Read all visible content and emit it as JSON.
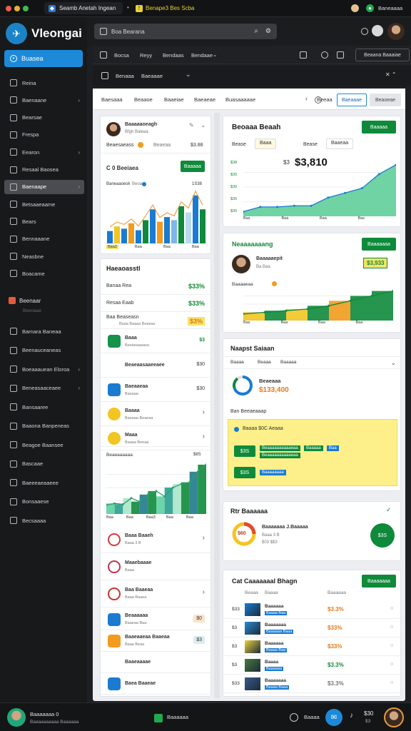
{
  "colors": {
    "accent": "#1c8ad8",
    "brand_green": "#0e8a3a",
    "chart_teal": "#5cd0a0",
    "warning_yellow": "#fdf08a",
    "orange": "#e47a18"
  },
  "browser": {
    "tab_title": "Seamb Anetah Ingean",
    "second_tab": "Benape3 Bes Scba",
    "profile_label": "Baneaaaa"
  },
  "app": {
    "name": "Vleongai"
  },
  "sidebar": {
    "primary_button": "Buasea",
    "items": [
      {
        "label": "Reina",
        "icon": "document-icon",
        "chevron": false
      },
      {
        "label": "Baenaane",
        "icon": "image-icon",
        "chevron": true
      },
      {
        "label": "Bearsae",
        "icon": "list-icon",
        "chevron": false
      },
      {
        "label": "Frespa",
        "icon": "folder-icon",
        "chevron": false
      },
      {
        "label": "Eearon",
        "icon": "mail-icon",
        "chevron": true
      },
      {
        "label": "Resaal Baosea",
        "icon": "calendar-icon",
        "chevron": false
      },
      {
        "label": "Baenaape",
        "icon": "camera-icon",
        "chevron": true
      },
      {
        "label": "Betsaaeaame",
        "icon": "globe-icon",
        "chevron": false
      },
      {
        "label": "Bears",
        "icon": "box-icon",
        "chevron": false
      },
      {
        "label": "Bennaaane",
        "icon": "pencil-icon",
        "chevron": false
      },
      {
        "label": "Neasbne",
        "icon": "grid-icon",
        "chevron": false
      },
      {
        "label": "Boacame",
        "icon": "lock-icon",
        "chevron": false
      }
    ],
    "section_label": "Beenaar",
    "section_sub": "Beenaae",
    "items2": [
      {
        "label": "Barnara Baneaa",
        "icon": "stack-icon",
        "chevron": false
      },
      {
        "label": "Beenauceaneas",
        "icon": "share-icon",
        "chevron": false
      },
      {
        "label": "Boeaaauean Eloroa",
        "icon": "folder-icon",
        "chevron": true
      },
      {
        "label": "Beneasaaceaee",
        "icon": "clipboard-icon",
        "chevron": true
      },
      {
        "label": "Bansaaree",
        "icon": "image-icon",
        "chevron": false
      },
      {
        "label": "Baaona Banpeneas",
        "icon": "video-icon",
        "chevron": false
      },
      {
        "label": "Beagoe Baansee",
        "icon": "camera-icon",
        "chevron": false
      },
      {
        "label": "Bascaae",
        "icon": "table-icon",
        "chevron": false
      },
      {
        "label": "Baeeeaeaaeee",
        "icon": "contact-icon",
        "chevron": false
      },
      {
        "label": "Bonsaaese",
        "icon": "window-icon",
        "chevron": false
      },
      {
        "label": "Becsaaaa",
        "icon": "mail-icon",
        "chevron": false
      }
    ]
  },
  "topbar": {
    "search_placeholder": "Boa Bearana"
  },
  "toolbar1": {
    "items": [
      "Bocsa",
      "Reyy",
      "Bendaas",
      "Bendaae"
    ],
    "right_label": "Beaana Baaaiae"
  },
  "toolbar2": {
    "items": [
      "Benaaa",
      "Baeaaae"
    ]
  },
  "tabs": {
    "items": [
      "Baesaaa",
      "Beaaoe",
      "Baaeiae",
      "Baeaeae",
      "Buasaaaaae"
    ],
    "right_text": "Beeaa",
    "active_button": "Baeaaae",
    "second_button": "Beaoeae"
  },
  "card_left_1": {
    "title": "Baaaaaoeagh",
    "subtitle": "Bfgh Baleaa",
    "row_label": "Beaesaeass",
    "row_mid": "Beaeaa",
    "row_right": "$3.88",
    "sub_title": "C 0 Beeiaea",
    "button": "Baaaaa",
    "chart_label": "Baneaaoesk",
    "chart_meta": "Beoa",
    "chart_top": "1S38",
    "x_labels": [
      "Baa3",
      "Baa",
      "Baa",
      "Baa"
    ],
    "chart_data": {
      "type": "bar",
      "categories": [
        "1",
        "2",
        "3",
        "4",
        "5",
        "6",
        "7",
        "8",
        "9",
        "10",
        "11",
        "12",
        "13",
        "14"
      ],
      "series": [
        {
          "values": [
            16,
            22,
            19,
            26,
            17,
            30,
            44,
            28,
            34,
            30,
            48,
            40,
            62,
            44
          ]
        }
      ],
      "ylim": [
        0,
        70
      ]
    }
  },
  "card_left_2": {
    "title": "Haeaoasstl",
    "rows": [
      {
        "label": "Banaa Rea",
        "value": "$33%"
      },
      {
        "label": "Resaa Eaab",
        "value": "$33%"
      },
      {
        "label": "Baa Beaseasn",
        "sub": "Baaa Baaaa Beaeas",
        "value": "$3%"
      }
    ]
  },
  "list_items": [
    {
      "title": "Baaa",
      "sub": "Beeaeaaaasa",
      "right": "$3",
      "color": "#16924a",
      "icon": "tag-icon"
    },
    {
      "title": "Beaeaasaaeeaee",
      "sub": "",
      "right": "$30",
      "color": "#ffffff",
      "icon": "bolt-icon"
    },
    {
      "title": "Baeaaeaa",
      "sub": "Baeaaa",
      "right": "$30",
      "color": "#1a7bd0",
      "icon": "document-icon"
    },
    {
      "title": "Baaaa",
      "sub": "Baeaaa Beaeaa",
      "right": "",
      "color": "#f2c522",
      "icon": "coin-icon"
    },
    {
      "title": "Maaa",
      "sub": "Baaaa Beeaa",
      "right": "",
      "color": "#f2c522",
      "icon": "bulb-icon"
    }
  ],
  "card_left_3": {
    "title": "Beaeaaaaaa",
    "chart_top": "$8S",
    "x_labels": [
      "Baa",
      "Baa",
      "Baa3",
      "Baa",
      "Baa"
    ],
    "chart_data": {
      "type": "area",
      "categories": [
        "1",
        "2",
        "3",
        "4",
        "5",
        "6",
        "7",
        "8",
        "9",
        "10",
        "11",
        "12",
        "13"
      ],
      "series": [
        {
          "values": [
            10,
            12,
            11,
            18,
            14,
            22,
            26,
            20,
            30,
            34,
            36,
            48,
            56
          ]
        }
      ],
      "ylim": [
        0,
        60
      ]
    }
  },
  "list_items2": [
    {
      "title": "Baaa Baaeh",
      "sub": "Baaa 3 B",
      "color": "#d33b3b",
      "icon": "alert-icon"
    },
    {
      "title": "Maaebaaae",
      "sub": "Baaa",
      "color": "#c2334d",
      "icon": "heart-icon"
    },
    {
      "title": "Baa Baaeaa",
      "sub": "Baaa Baaea",
      "color": "#c8352f",
      "icon": "camera-icon"
    }
  ],
  "list_items3": [
    {
      "title": "Beaaaaaa",
      "sub": "Baaeaa Baa",
      "badge": "$0",
      "color": "#1a7bd0",
      "icon": "folder-icon"
    },
    {
      "title": "Baaeaaeaa Baaeaa",
      "sub": "Baaa Beaa",
      "badge": "$3",
      "color": "#f29b1e",
      "icon": "grid-icon"
    },
    {
      "title": "Baaeaaaae",
      "sub": "",
      "badge": "",
      "color": "#ffffff",
      "icon": "dot-icon"
    },
    {
      "title": "Baea Baaeae",
      "sub": "",
      "badge": "",
      "color": "#1a7bd0",
      "icon": "box-icon"
    }
  ],
  "card_right_1": {
    "title": "Beoaaa Beaah",
    "tag1": "Baaa",
    "tag2": "Baaeaa",
    "label": "Bease",
    "button": "Baaaaa",
    "value": "$3,810",
    "small_value": "$3",
    "x_labels": [
      "Bas",
      "Baa",
      "Baa",
      "Bas"
    ],
    "y_labels": [
      "$38",
      "$30",
      "$30",
      "$30",
      "$30"
    ],
    "chart_data": {
      "type": "area",
      "categories": [
        "1",
        "2",
        "3",
        "4",
        "5",
        "6",
        "7",
        "8",
        "9",
        "10"
      ],
      "series": [
        {
          "values": [
            4,
            8,
            8,
            9,
            9,
            16,
            20,
            24,
            36,
            44
          ]
        }
      ],
      "ylim": [
        0,
        50
      ]
    }
  },
  "card_right_2": {
    "title": "Neaaaaaaang",
    "button": "Baaaaaaa",
    "name": "Baaaaaepit",
    "sub": "Ba Baa",
    "value_badge": "$3,933",
    "row_label": "Baaaaeaa",
    "x_labels": [
      "Bas",
      "Baa",
      "Baa",
      "Baa"
    ],
    "chart_data": {
      "type": "area",
      "categories": [
        "1",
        "2",
        "3",
        "4",
        "5",
        "6",
        "7",
        "8"
      ],
      "series": [
        {
          "values": [
            8,
            10,
            12,
            14,
            18,
            24,
            30,
            36
          ]
        }
      ],
      "ylim": [
        0,
        40
      ]
    }
  },
  "card_right_3": {
    "title": "Naapst Saiaan",
    "tabs": [
      "Baaaa",
      "Beaaa",
      "Baaaaa"
    ],
    "donut_title": "Beaeaaa",
    "donut_value": "$133,400",
    "section": "Ban Beeaeaaap",
    "alert_title": "Baaaa $0C Aeaaa",
    "alert_rows": [
      {
        "value": "$3S",
        "label": "Beaaaaaaaaaaeaa",
        "pill": "Baaaaa",
        "pill2": "Baa"
      },
      {
        "value": "$3S",
        "label": "Baaaaaaaa"
      }
    ],
    "donut": {
      "values": [
        70,
        20,
        10
      ]
    }
  },
  "card_right_4": {
    "title": "Rtr Baaaaaa",
    "gauge_label": "$60",
    "name": "Baaaaaaa J.Baaaaa",
    "sub": "Baaa 3 B",
    "sub2": "$03 $$3",
    "circle": "$3S"
  },
  "card_right_5": {
    "title": "Cat Caaaaaaal Bhagn",
    "button": "Baaaaaaa",
    "headers": [
      "Beaaa",
      "Baaaa",
      "Baaaaaa"
    ],
    "rows": [
      {
        "n": "$33",
        "name": "Baaaaaa",
        "sub": "Baaaa Baa",
        "value": "$3.3%",
        "color": "#e47a18"
      },
      {
        "n": "$3",
        "name": "Baaaaaaa",
        "sub": "Baaaaaa Baaa",
        "value": "$33%",
        "color": "#e47a18"
      },
      {
        "n": "$3",
        "name": "Baaaaaa",
        "sub": "Baaaa Baa",
        "value": "$33%",
        "color": "#e47a18"
      },
      {
        "n": "$3",
        "name": "Baaaa",
        "sub": "Baaaaaa",
        "value": "$3.3%",
        "color": "#138a36"
      },
      {
        "n": "$33",
        "name": "Baaaaaaa",
        "sub": "Baaaa Baaa",
        "value": "$3.3%",
        "color": "#777777"
      }
    ]
  },
  "bottombar": {
    "user": "Baaaaaaa 0",
    "user_sub": "Baaaaaaaaaa Baaaaaa",
    "center": "Baaaaaa",
    "right_label": "Baaaa",
    "time": "$30",
    "time_sub": "$3"
  }
}
